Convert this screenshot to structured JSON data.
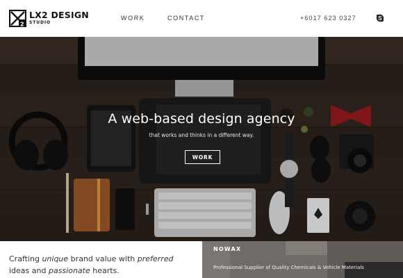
{
  "header": {
    "logo_title": "LX2 DESIGN",
    "logo_subtitle": "STUDIO",
    "nav": {
      "work": "WORK",
      "contact": "CONTACT"
    },
    "phone": "+6017 623 0327",
    "social_icon": "skype-icon"
  },
  "hero": {
    "title": "A web-based design agency",
    "subtitle": "that works and thinks in a different way.",
    "button_label": "WORK"
  },
  "intro": {
    "part1": "Crafting ",
    "em1": "unique",
    "part2": " brand value with ",
    "em2": "preferred",
    "part3": " ideas and ",
    "em3": "passionate",
    "part4": " hearts."
  },
  "project": {
    "name": "NOWAX",
    "description": "Professional Supplier of Quality Chemicals & Vehicle Materials"
  },
  "colors": {
    "header_bg": "#ffffff",
    "text_dark": "#111111",
    "hero_overlay_text": "#ffffff",
    "project_bg": "#6d6a66"
  }
}
